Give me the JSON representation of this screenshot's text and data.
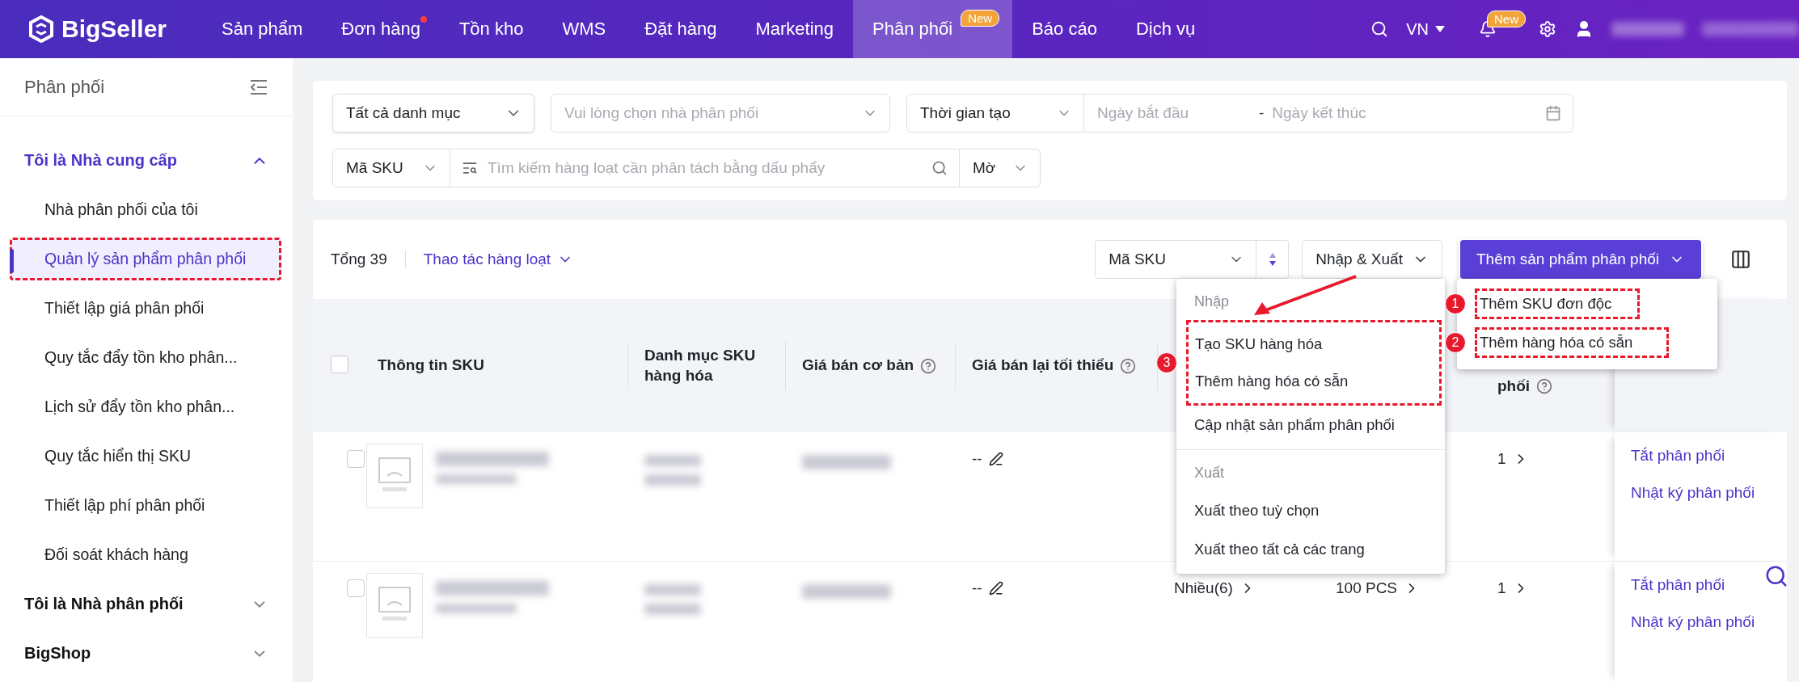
{
  "topbar": {
    "logo": "BigSeller",
    "nav": [
      {
        "label": "Sản phẩm",
        "selected": false,
        "dot": false
      },
      {
        "label": "Đơn hàng",
        "selected": false,
        "dot": true
      },
      {
        "label": "Tồn kho",
        "selected": false,
        "dot": false
      },
      {
        "label": "WMS",
        "selected": false,
        "dot": false
      },
      {
        "label": "Đặt hàng",
        "selected": false,
        "dot": false
      },
      {
        "label": "Marketing",
        "selected": false,
        "dot": false
      },
      {
        "label": "Phân phối",
        "selected": true,
        "dot": false,
        "badge": "New"
      },
      {
        "label": "Báo cáo",
        "selected": false,
        "dot": false
      },
      {
        "label": "Dịch vụ",
        "selected": false,
        "dot": false
      }
    ],
    "language": "VN",
    "notification_badge": "New"
  },
  "sidebar": {
    "title": "Phân phối",
    "groups": [
      {
        "label": "Tôi là Nhà cung cấp",
        "expanded": true,
        "children": [
          {
            "label": "Nhà phân phối của tôi",
            "selected": false,
            "highlighted": false
          },
          {
            "label": "Quản lý sản phẩm phân phối",
            "selected": true,
            "highlighted": true
          },
          {
            "label": "Thiết lập giá phân phối",
            "selected": false,
            "highlighted": false
          },
          {
            "label": "Quy tắc đẩy tồn kho phân...",
            "selected": false,
            "highlighted": false
          },
          {
            "label": "Lịch sử đẩy tồn kho phân...",
            "selected": false,
            "highlighted": false
          },
          {
            "label": "Quy tắc hiển thị SKU",
            "selected": false,
            "highlighted": false
          },
          {
            "label": "Thiết lập phí phân phối",
            "selected": false,
            "highlighted": false
          },
          {
            "label": "Đối soát khách hàng",
            "selected": false,
            "highlighted": false
          }
        ]
      },
      {
        "label": "Tôi là Nhà phân phối",
        "expanded": false
      },
      {
        "label": "BigShop",
        "expanded": false
      }
    ]
  },
  "filters": {
    "category": "Tất cả danh mục",
    "distributor": {
      "placeholder": "Vui lòng chọn nhà phân phối"
    },
    "time_type": "Thời gian tạo",
    "start_date": {
      "placeholder": "Ngày bắt đầu"
    },
    "date_separator": "-",
    "end_date": {
      "placeholder": "Ngày kết thúc"
    },
    "search_field": "Mã SKU",
    "search": {
      "placeholder": "Tìm kiếm hàng loạt cần phân tách bằng dấu phẩy"
    },
    "match_mode": "Mờ"
  },
  "toolbar": {
    "total": "Tổng 39",
    "bulk_action": "Thao tác hàng loạt",
    "sort_field": "Mã SKU",
    "import_export": "Nhập & Xuất",
    "add_button": "Thêm sản phẩm phân phối"
  },
  "table": {
    "header_checked": false,
    "columns": [
      {
        "label": "Thông tin SKU"
      },
      {
        "label": "Danh mục SKU hàng hóa"
      },
      {
        "label": "Giá bán cơ bản",
        "help": true
      },
      {
        "label": "Giá bán lại tối thiểu",
        "help": true
      }
    ],
    "column_8": {
      "label": "phối",
      "help": true
    },
    "rows": [
      {
        "checked": false,
        "min_price": "--",
        "stores": "1",
        "actions": [
          "Tắt phân phối",
          "Nhật ký phân phối"
        ]
      },
      {
        "checked": false,
        "min_price": "--",
        "variants": "Nhiều(6)",
        "stock": "100 PCS",
        "stores": "1",
        "actions": [
          "Tắt phân phối",
          "Nhật ký phân phối"
        ]
      }
    ]
  },
  "import_export_menu": {
    "sections": [
      {
        "title": "Nhập",
        "badge": "3",
        "items": [
          {
            "label": "Tạo SKU hàng hóa",
            "highlighted": true
          },
          {
            "label": "Thêm hàng hóa có sẵn",
            "highlighted": true
          },
          {
            "label": "Cập nhật sản phẩm phân phối",
            "highlighted": false
          }
        ]
      },
      {
        "title": "Xuất",
        "items": [
          {
            "label": "Xuất theo tuỳ chọn",
            "highlighted": false
          },
          {
            "label": "Xuất theo tất cả các trang",
            "highlighted": false
          }
        ]
      }
    ]
  },
  "add_menu": {
    "items": [
      {
        "label": "Thêm SKU đơn độc",
        "highlighted": true,
        "badge": "1"
      },
      {
        "label": "Thêm hàng hóa có sẵn",
        "highlighted": true,
        "badge": "2"
      }
    ]
  }
}
